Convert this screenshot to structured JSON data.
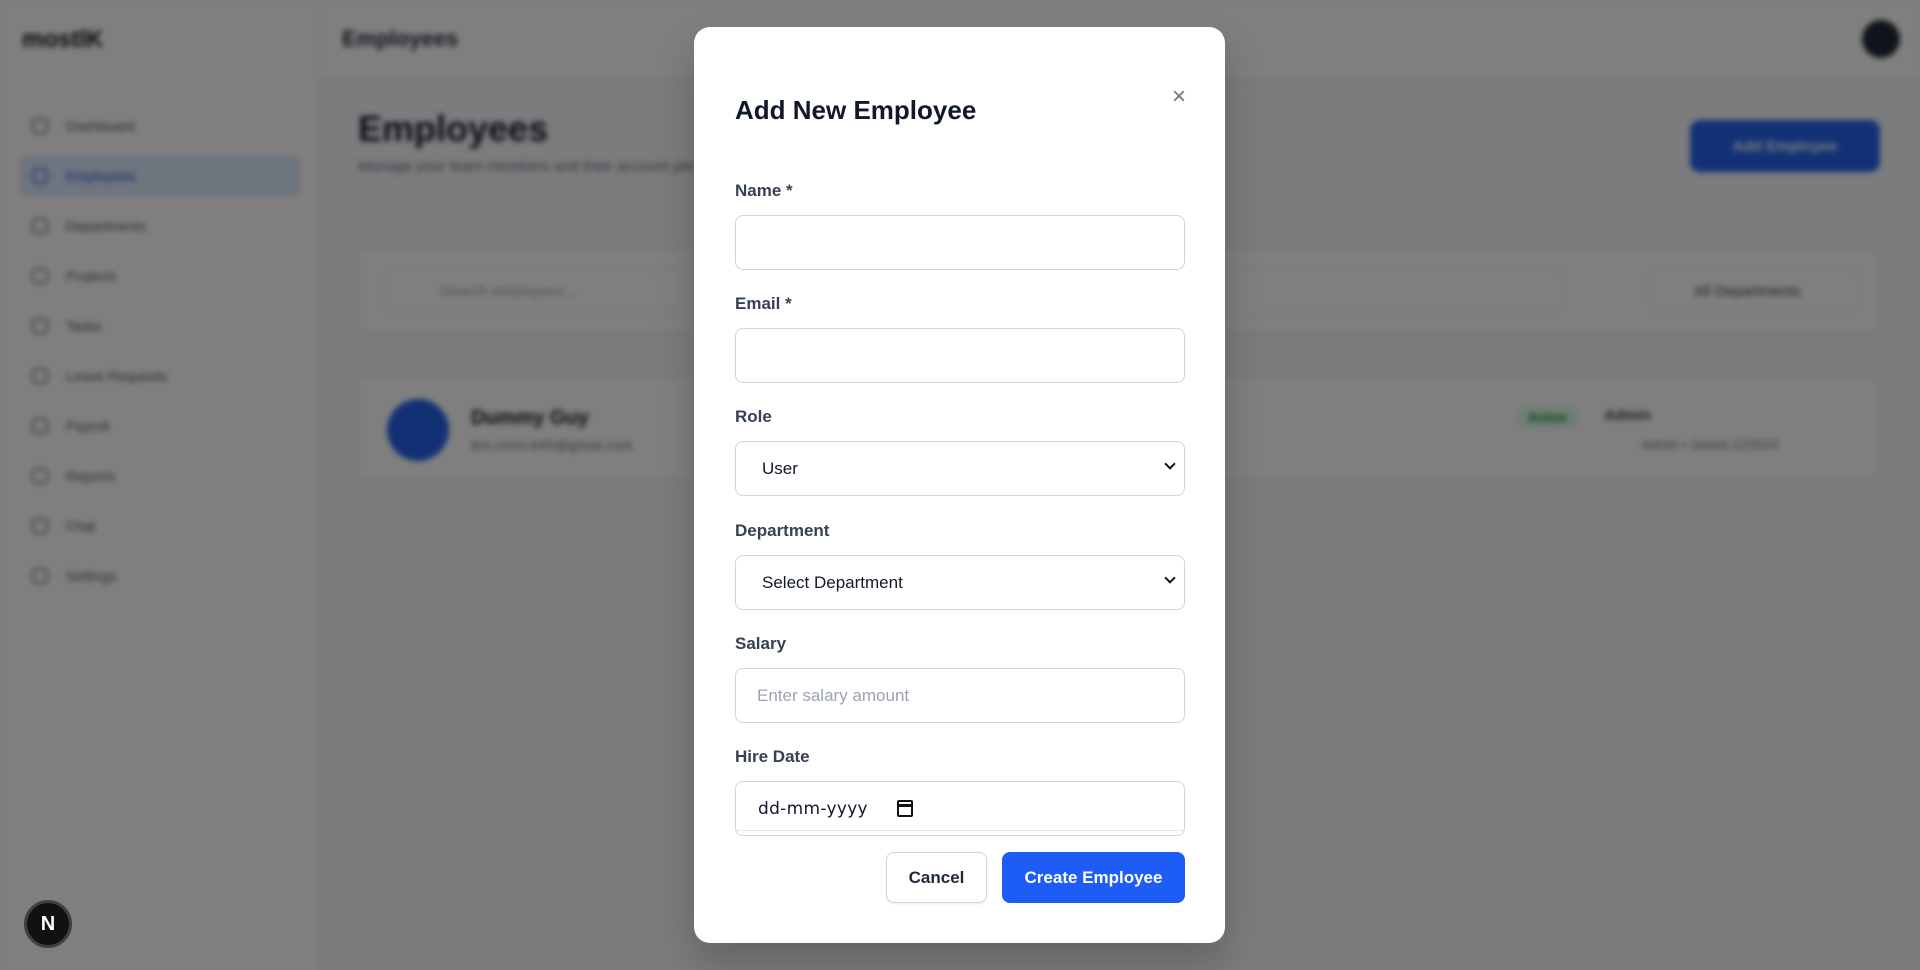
{
  "background": {
    "logo": "mostlK",
    "breadcrumb": "Employees",
    "sidebar": [
      {
        "label": "Dashboard",
        "active": false
      },
      {
        "label": "Employees",
        "active": true
      },
      {
        "label": "Departments",
        "active": false
      },
      {
        "label": "Projects",
        "active": false
      },
      {
        "label": "Tasks",
        "active": false
      },
      {
        "label": "Leave Requests",
        "active": false
      },
      {
        "label": "Payroll",
        "active": false
      },
      {
        "label": "Reports",
        "active": false
      },
      {
        "label": "Chat",
        "active": false
      },
      {
        "label": "Settings",
        "active": false
      }
    ],
    "page_title": "Employees",
    "page_subtitle": "Manage your team members and their account permissions",
    "add_button": "Add Employee",
    "search_placeholder": "Search employees...",
    "department_filter": "All Departments",
    "employee": {
      "name": "Dummy Guy",
      "email": "bro.ronm.b45@gmail.com",
      "status": "Active",
      "role": "Admin",
      "meta": "Admin • Joined 12/2024"
    }
  },
  "modal": {
    "title": "Add New Employee",
    "close_icon": "close-icon",
    "fields": {
      "name_label": "Name *",
      "name_value": "",
      "email_label": "Email *",
      "email_value": "",
      "role_label": "Role",
      "role_value": "User",
      "department_label": "Department",
      "department_value": "Select Department",
      "salary_label": "Salary",
      "salary_placeholder": "Enter salary amount",
      "hire_date_label": "Hire Date",
      "hire_date_placeholder": "dd-mm-yyyy"
    },
    "buttons": {
      "cancel": "Cancel",
      "create": "Create Employee"
    }
  },
  "dev_badge": "N",
  "colors": {
    "primary": "#1d5cf5",
    "overlay": "rgba(0,0,0,0.5)"
  }
}
